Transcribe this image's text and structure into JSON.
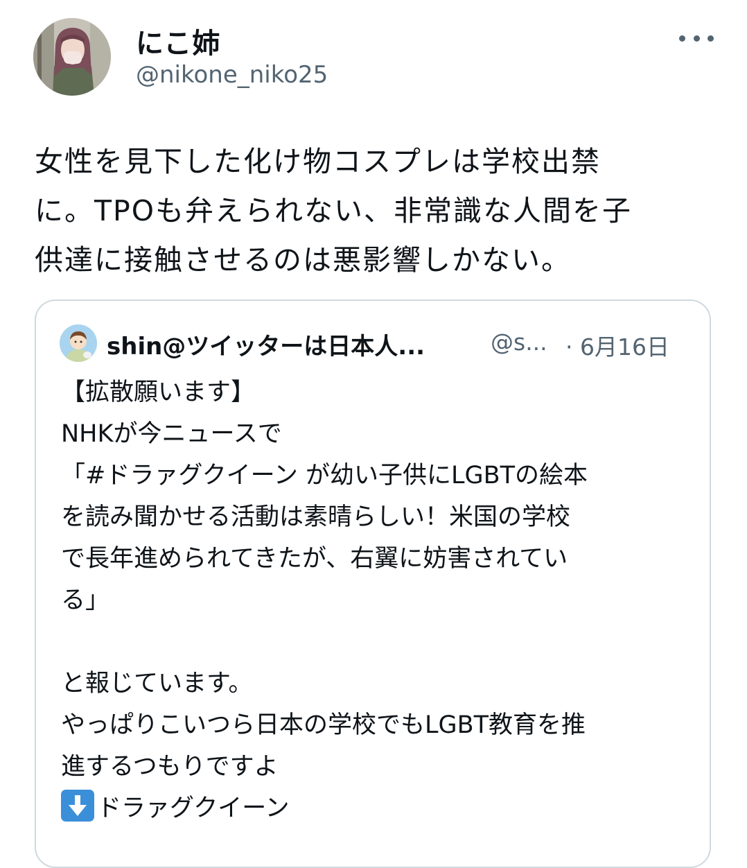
{
  "author": {
    "display_name": "にこ姉",
    "handle": "@nikone_niko25",
    "avatar_icon": "profile-photo-icon"
  },
  "more_icon": "more-options-icon",
  "tweet": {
    "lines": [
      "女性を見下した化け物コスプレは学校出禁",
      "に。TPOも弁えられない、非常識な人間を子",
      "供達に接触させるのは悪影響しかない。"
    ]
  },
  "quote": {
    "name": "shin@ツイッターは日本人...",
    "handle": "@s...",
    "date": "· 6月16日",
    "lines": [
      "【拡散願います】",
      "NHKが今ニュースで",
      "「#ドラァグクイーン が幼い子供にLGBTの絵本",
      "を読み聞かせる活動は素晴らしい！米国の学校",
      "で長年進められてきたが、右翼に妨害されてい",
      "る」",
      "",
      "と報じています。",
      "やっぱりこいつら日本の学校でもLGBT教育を推",
      "進するつもりですよ"
    ],
    "last_line": "ドラァグクイーン",
    "last_line_emoji": "down-arrow-emoji-icon"
  },
  "colors": {
    "text": "#0f1419",
    "secondary_text": "#536471",
    "border": "#cfd9de",
    "emoji_blue": "#3b8fd9"
  }
}
